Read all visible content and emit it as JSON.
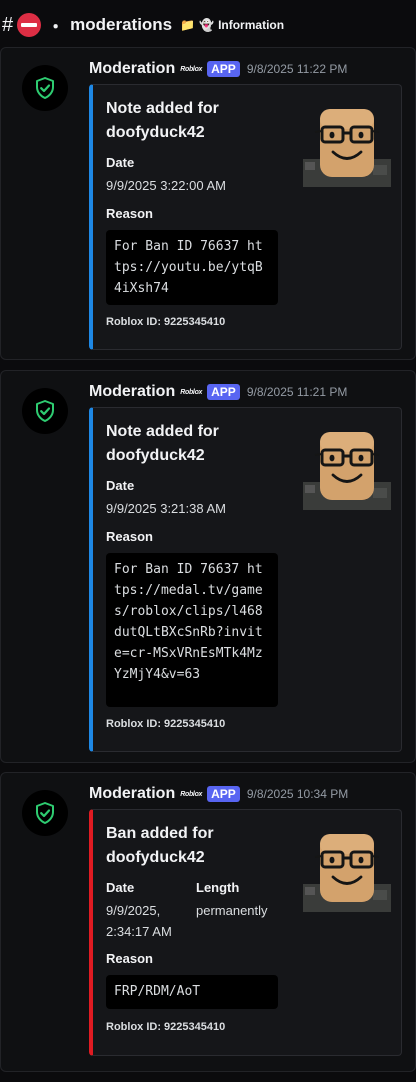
{
  "header": {
    "hash": "#",
    "sep": "・",
    "channel": "moderations",
    "folder_glyph": "📁",
    "ghost_glyph": "👻",
    "info": "Information"
  },
  "messages": [
    {
      "author": "Moderation",
      "rbadge": "Roblox",
      "app": "APP",
      "time": "9/8/2025 11:22 PM",
      "embed": {
        "title": "Note added for doofyduck42",
        "date_label": "Date",
        "date": "9/9/2025 3:22:00 AM",
        "reason_label": "Reason",
        "reason": "For Ban ID 76637 https://youtu.be/ytqB4iXsh74",
        "footer": "Roblox ID: 9225345410"
      }
    },
    {
      "author": "Moderation",
      "rbadge": "Roblox",
      "app": "APP",
      "time": "9/8/2025 11:21 PM",
      "embed": {
        "title": "Note added for doofyduck42",
        "date_label": "Date",
        "date": "9/9/2025 3:21:38 AM",
        "reason_label": "Reason",
        "reason": "For Ban ID 76637 https://medal.tv/games/roblox/clips/l468dutQLtBXcSnRb?invite=cr-MSxVRnEsMTk4MzYzMjY4&v=63",
        "footer": "Roblox ID: 9225345410"
      }
    },
    {
      "author": "Moderation",
      "rbadge": "Roblox",
      "app": "APP",
      "time": "9/8/2025 10:34 PM",
      "embed": {
        "title": "Ban added for doofyduck42",
        "date_label": "Date",
        "date": "9/9/2025, 2:34:17 AM",
        "length_label": "Length",
        "length": "permanently",
        "reason_label": "Reason",
        "reason": "FRP/RDM/AoT",
        "footer": "Roblox ID: 9225345410"
      }
    }
  ],
  "colors": {
    "note_accent": "#1e88e5",
    "ban_accent": "#e01b22",
    "app_badge": "#5865f2",
    "shield": "#2ecc71"
  },
  "icons": [
    "shield-check-icon",
    "no-entry-icon",
    "folder-icon",
    "ghost-icon",
    "roblox-avatar-thumbnail"
  ]
}
